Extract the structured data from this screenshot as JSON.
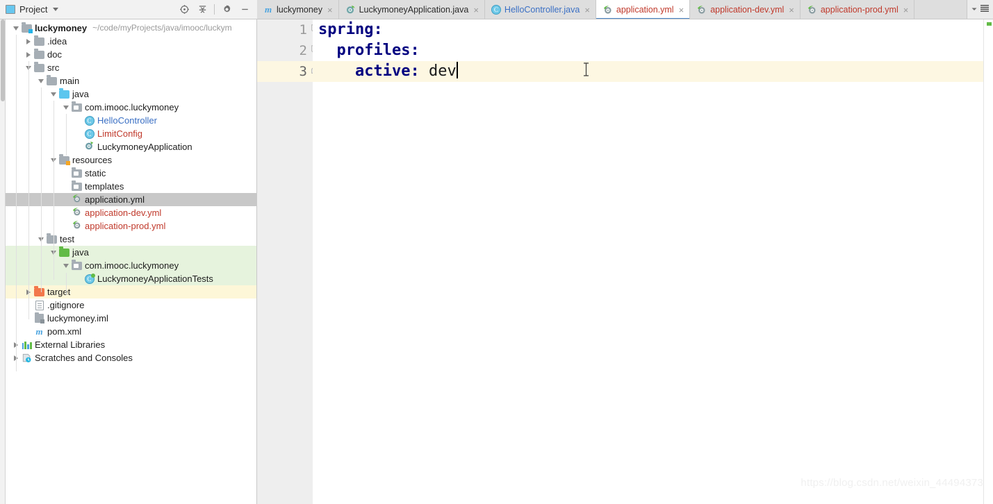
{
  "panel": {
    "title": "Project",
    "icon": "project-panel-icon",
    "dropdown_icon": "chevron-down-icon",
    "tools": [
      {
        "name": "locate-in-tree-icon",
        "title": "Select Opened File"
      },
      {
        "name": "collapse-all-icon",
        "title": "Collapse All"
      },
      {
        "name": "gear-icon",
        "title": "Settings"
      },
      {
        "name": "minimize-icon",
        "title": "Hide"
      }
    ]
  },
  "tabs": [
    {
      "label": "luckymoney",
      "icon": "maven-icon",
      "color_class": "c-dark",
      "active": false,
      "close": "×"
    },
    {
      "label": "LuckymoneyApplication.java",
      "icon": "spring-boot-icon",
      "color_class": "c-dark",
      "active": false,
      "close": "×"
    },
    {
      "label": "HelloController.java",
      "icon": "java-class-icon",
      "color_class": "c-blue",
      "active": false,
      "close": "×"
    },
    {
      "label": "application.yml",
      "icon": "spring-yaml-icon",
      "color_class": "c-red",
      "active": true,
      "close": "×"
    },
    {
      "label": "application-dev.yml",
      "icon": "spring-yaml-icon",
      "color_class": "c-red",
      "active": false,
      "close": "×"
    },
    {
      "label": "application-prod.yml",
      "icon": "spring-yaml-icon",
      "color_class": "c-red",
      "active": false,
      "close": "×"
    }
  ],
  "tab_actions": [
    {
      "name": "tab-list-dropdown-icon"
    },
    {
      "name": "tab-menu-icon"
    }
  ],
  "tree": [
    {
      "label": "luckymoney",
      "sub": "~/code/myProjects/java/imooc/luckym",
      "depth": 0,
      "arrow": "down",
      "icon": "module-folder-icon",
      "style": "t-bold",
      "bg": ""
    },
    {
      "label": ".idea",
      "sub": "",
      "depth": 1,
      "arrow": "right",
      "icon": "folder-gray-icon",
      "style": "t-black",
      "bg": ""
    },
    {
      "label": "doc",
      "sub": "",
      "depth": 1,
      "arrow": "right",
      "icon": "folder-gray-icon",
      "style": "t-black",
      "bg": ""
    },
    {
      "label": "src",
      "sub": "",
      "depth": 1,
      "arrow": "down",
      "icon": "folder-gray-icon",
      "style": "t-black",
      "bg": ""
    },
    {
      "label": "main",
      "sub": "",
      "depth": 2,
      "arrow": "down",
      "icon": "folder-gray-icon",
      "style": "t-black",
      "bg": ""
    },
    {
      "label": "java",
      "sub": "",
      "depth": 3,
      "arrow": "down",
      "icon": "folder-blue-icon",
      "style": "t-black",
      "bg": ""
    },
    {
      "label": "com.imooc.luckymoney",
      "sub": "",
      "depth": 4,
      "arrow": "down",
      "icon": "package-icon",
      "style": "t-black",
      "bg": ""
    },
    {
      "label": "HelloController",
      "sub": "",
      "depth": 5,
      "arrow": "none",
      "icon": "java-class-icon",
      "style": "t-blue",
      "bg": ""
    },
    {
      "label": "LimitConfig",
      "sub": "",
      "depth": 5,
      "arrow": "none",
      "icon": "java-class-icon",
      "style": "t-red",
      "bg": ""
    },
    {
      "label": "LuckymoneyApplication",
      "sub": "",
      "depth": 5,
      "arrow": "none",
      "icon": "spring-boot-run-icon",
      "style": "t-black",
      "bg": ""
    },
    {
      "label": "resources",
      "sub": "",
      "depth": 3,
      "arrow": "down",
      "icon": "resources-folder-icon",
      "style": "t-black",
      "bg": ""
    },
    {
      "label": "static",
      "sub": "",
      "depth": 4,
      "arrow": "none",
      "icon": "package-icon",
      "style": "t-black",
      "bg": ""
    },
    {
      "label": "templates",
      "sub": "",
      "depth": 4,
      "arrow": "none",
      "icon": "package-icon",
      "style": "t-black",
      "bg": ""
    },
    {
      "label": "application.yml",
      "sub": "",
      "depth": 4,
      "arrow": "none",
      "icon": "spring-yaml-icon",
      "style": "t-black",
      "bg": "sel-gray"
    },
    {
      "label": "application-dev.yml",
      "sub": "",
      "depth": 4,
      "arrow": "none",
      "icon": "spring-yaml-icon",
      "style": "t-red",
      "bg": ""
    },
    {
      "label": "application-prod.yml",
      "sub": "",
      "depth": 4,
      "arrow": "none",
      "icon": "spring-yaml-icon",
      "style": "t-red",
      "bg": ""
    },
    {
      "label": "test",
      "sub": "",
      "depth": 2,
      "arrow": "down",
      "icon": "folder-gray-icon",
      "style": "t-black",
      "bg": ""
    },
    {
      "label": "java",
      "sub": "",
      "depth": 3,
      "arrow": "down",
      "icon": "folder-green-icon",
      "style": "t-black",
      "bg": "bg-green"
    },
    {
      "label": "com.imooc.luckymoney",
      "sub": "",
      "depth": 4,
      "arrow": "down",
      "icon": "package-icon",
      "style": "t-black",
      "bg": "bg-green"
    },
    {
      "label": "LuckymoneyApplicationTests",
      "sub": "",
      "depth": 5,
      "arrow": "none",
      "icon": "java-test-class-icon",
      "style": "t-black",
      "bg": "bg-green"
    },
    {
      "label": "target",
      "sub": "",
      "depth": 1,
      "arrow": "right",
      "icon": "folder-orange-icon",
      "style": "t-black",
      "bg": "bg-yellow"
    },
    {
      "label": ".gitignore",
      "sub": "",
      "depth": 1,
      "arrow": "none",
      "icon": "file-icon",
      "style": "t-black",
      "bg": ""
    },
    {
      "label": "luckymoney.iml",
      "sub": "",
      "depth": 1,
      "arrow": "none",
      "icon": "iml-file-icon",
      "style": "t-black",
      "bg": ""
    },
    {
      "label": "pom.xml",
      "sub": "",
      "depth": 1,
      "arrow": "none",
      "icon": "maven-icon",
      "style": "t-black",
      "bg": ""
    },
    {
      "label": "External Libraries",
      "sub": "",
      "depth": 0,
      "arrow": "right",
      "icon": "libraries-icon",
      "style": "t-black",
      "bg": ""
    },
    {
      "label": "Scratches and Consoles",
      "sub": "",
      "depth": 0,
      "arrow": "right",
      "icon": "scratches-icon",
      "style": "t-black",
      "bg": ""
    }
  ],
  "editor": {
    "line_numbers": [
      "1",
      "2",
      "3"
    ],
    "fold_markers": [
      "fold-collapse-start-icon",
      "fold-collapse-start-icon",
      "fold-collapse-end-icon"
    ],
    "lines": [
      {
        "indent": "",
        "key": "spring",
        "colon": ":",
        "value": "",
        "current": false
      },
      {
        "indent": "  ",
        "key": "profiles",
        "colon": ":",
        "value": "",
        "current": false
      },
      {
        "indent": "    ",
        "key": "active",
        "colon": ":",
        "value": " dev",
        "current": true
      }
    ],
    "caret_after": "dev",
    "mouse_cursor": "text-ibeam-cursor"
  },
  "watermark": "https://blog.csdn.net/weixin_44494373",
  "colors": {
    "accent_tab_underline": "#4a86c8",
    "yaml_key": "#000080",
    "selected_row": "#c8c8c8",
    "test_source_bg": "#e6f3dd",
    "excluded_bg": "#fdf7d8",
    "current_line_bg": "#fdf7e2",
    "red_file": "#c0392b",
    "blue_file": "#3a6fc4"
  }
}
